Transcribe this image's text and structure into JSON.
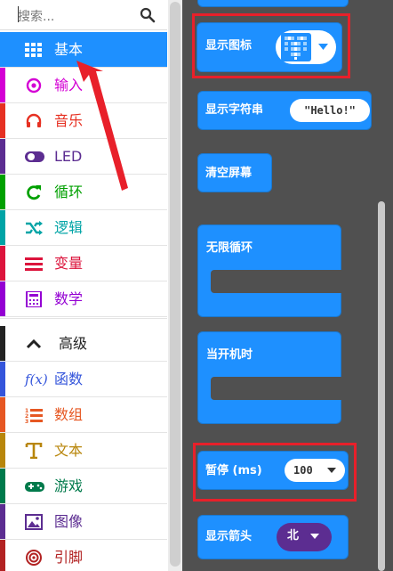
{
  "toolbox": {
    "search_placeholder": "搜索...",
    "categories": [
      {
        "label": "基本",
        "icon": "grid-icon",
        "color": "#1e90ff",
        "selected": true
      },
      {
        "label": "输入",
        "icon": "target-icon",
        "color": "#d400d4"
      },
      {
        "label": "音乐",
        "icon": "headphones-icon",
        "color": "#e63022"
      },
      {
        "label": "LED",
        "icon": "toggle-icon",
        "color": "#5c2d91"
      },
      {
        "label": "循环",
        "icon": "refresh-icon",
        "color": "#00a000"
      },
      {
        "label": "逻辑",
        "icon": "shuffle-icon",
        "color": "#00a4a6"
      },
      {
        "label": "变量",
        "icon": "list-icon",
        "color": "#dc143c"
      },
      {
        "label": "数学",
        "icon": "calculator-icon",
        "color": "#9400d3"
      }
    ],
    "advanced": {
      "label": "高级",
      "icon": "chevron-up-icon",
      "color": "#222222"
    },
    "advanced_categories": [
      {
        "label": "函数",
        "icon": "function-icon",
        "color": "#3455db"
      },
      {
        "label": "数组",
        "icon": "numbered-list-icon",
        "color": "#e65722"
      },
      {
        "label": "文本",
        "icon": "text-icon",
        "color": "#b8860b"
      },
      {
        "label": "游戏",
        "icon": "gamepad-icon",
        "color": "#007a4b"
      },
      {
        "label": "图像",
        "icon": "image-icon",
        "color": "#5c2d91"
      },
      {
        "label": "引脚",
        "icon": "pins-icon",
        "color": "#b22222"
      }
    ]
  },
  "blocks": {
    "show_icon": "显示图标",
    "show_string": "显示字符串",
    "show_string_value": "\"Hello!\"",
    "clear_screen": "清空屏幕",
    "forever": "无限循环",
    "on_start": "当开机时",
    "pause": "暂停 (ms)",
    "pause_value": "100",
    "show_arrow": "显示箭头",
    "show_arrow_value": "北"
  },
  "colors": {
    "accent": "#1e90ff",
    "highlight": "#e8202a",
    "flyout_bg": "#505050"
  }
}
